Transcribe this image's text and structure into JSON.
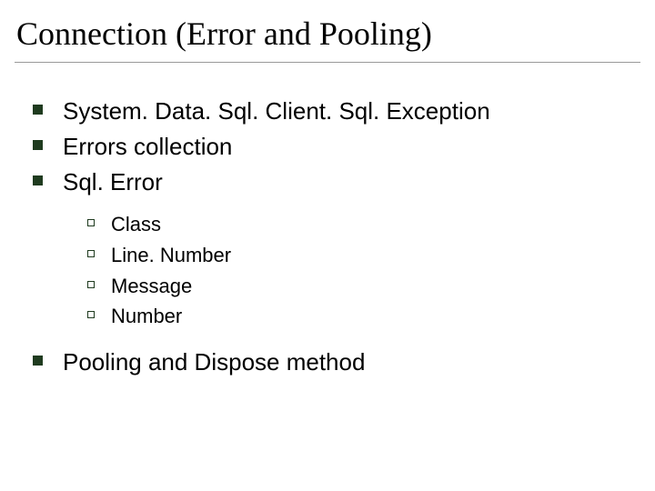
{
  "title": "Connection (Error and Pooling)",
  "items": [
    {
      "text": "System. Data. Sql. Client. Sql. Exception"
    },
    {
      "text": "Errors collection"
    },
    {
      "text": "Sql. Error"
    }
  ],
  "subitems": [
    {
      "text": "Class"
    },
    {
      "text": "Line. Number"
    },
    {
      "text": "Message"
    },
    {
      "text": "Number"
    }
  ],
  "items2": [
    {
      "text": "Pooling and Dispose method"
    }
  ]
}
